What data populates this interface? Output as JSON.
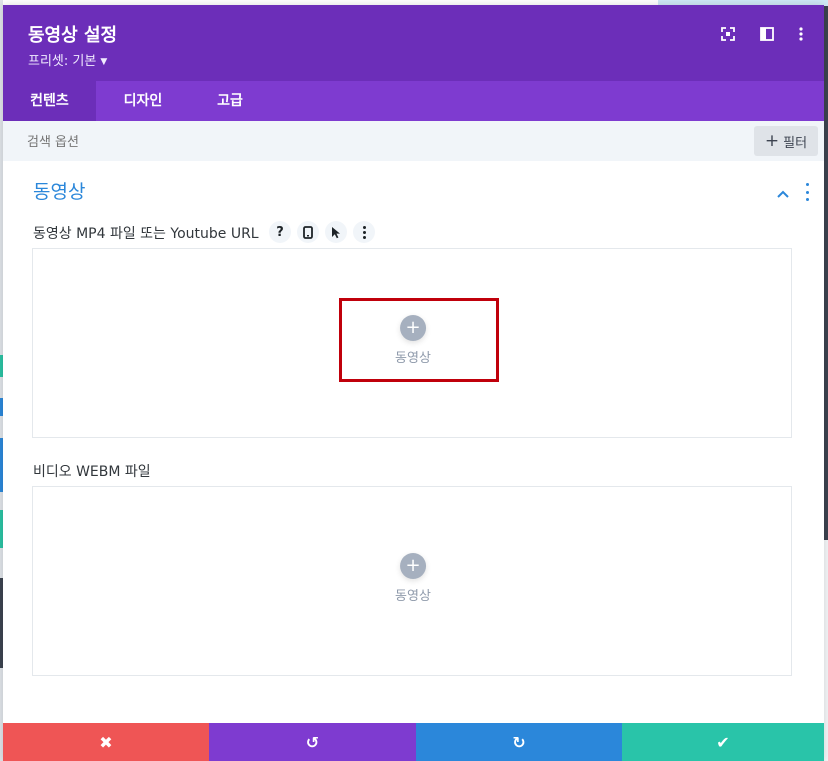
{
  "modal": {
    "title": "동영상 설정",
    "preset_label": "프리셋: 기본",
    "header_icons": [
      "expand-icon",
      "split-view-icon",
      "more-vertical-icon"
    ]
  },
  "tabs": [
    {
      "label": "컨텐츠",
      "active": true
    },
    {
      "label": "디자인",
      "active": false
    },
    {
      "label": "고급",
      "active": false
    }
  ],
  "search": {
    "placeholder": "검색 옵션",
    "filter_label": "필터"
  },
  "section": {
    "title": "동영상",
    "fields": [
      {
        "label": "동영상 MP4 파일 또는 Youtube URL",
        "help_icon": "?",
        "upload_label": "동영상",
        "highlighted": true
      },
      {
        "label": "비디오 WEBM 파일",
        "upload_label": "동영상",
        "highlighted": false
      }
    ]
  },
  "footer": {
    "buttons": [
      {
        "name": "discard",
        "icon": "✖",
        "color": "#ef5555"
      },
      {
        "name": "undo",
        "icon": "↺",
        "color": "#7e3bd0"
      },
      {
        "name": "redo",
        "icon": "↻",
        "color": "#2b87da"
      },
      {
        "name": "save",
        "icon": "✔",
        "color": "#29c4a9"
      }
    ]
  },
  "colors": {
    "header": "#6c2eb9",
    "tabs": "#7e3bd0",
    "accent": "#2b87da",
    "highlight_border": "#c0000b"
  }
}
